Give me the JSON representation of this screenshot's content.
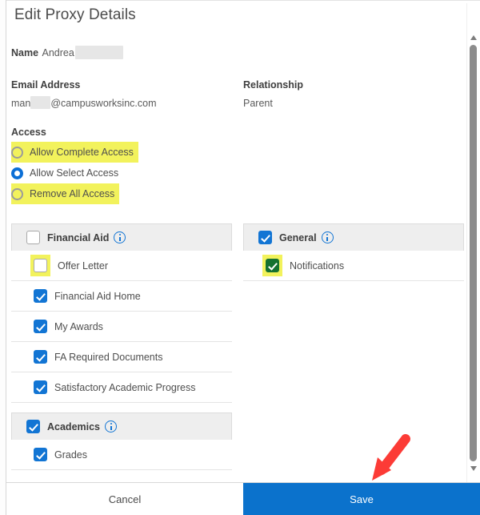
{
  "dialog": {
    "title": "Edit Proxy Details"
  },
  "info": {
    "name_label": "Name",
    "name_value": "Andrea",
    "email_label": "Email Address",
    "email_prefix": "man",
    "email_suffix": "@campusworksinc.com",
    "relationship_label": "Relationship",
    "relationship_value": "Parent"
  },
  "access": {
    "label": "Access",
    "options": [
      {
        "label": "Allow Complete Access",
        "selected": false,
        "highlighted": true
      },
      {
        "label": "Allow Select Access",
        "selected": true,
        "highlighted": false
      },
      {
        "label": "Remove All Access",
        "selected": false,
        "highlighted": true
      }
    ]
  },
  "permissions": {
    "left_column": [
      {
        "group": "Financial Aid",
        "checked": false,
        "has_info_icon": true,
        "items": [
          {
            "label": "Offer Letter",
            "checked": false,
            "highlighted": true,
            "color": "white"
          },
          {
            "label": "Financial Aid Home",
            "checked": true,
            "highlighted": false,
            "color": "blue"
          },
          {
            "label": "My Awards",
            "checked": true,
            "highlighted": false,
            "color": "blue"
          },
          {
            "label": "FA Required Documents",
            "checked": true,
            "highlighted": false,
            "color": "blue"
          },
          {
            "label": "Satisfactory Academic Progress",
            "checked": true,
            "highlighted": false,
            "color": "blue"
          }
        ]
      },
      {
        "group": "Academics",
        "checked": true,
        "has_info_icon": true,
        "items": [
          {
            "label": "Grades",
            "checked": true,
            "highlighted": false,
            "color": "blue"
          }
        ]
      }
    ],
    "right_column": [
      {
        "group": "General",
        "checked": true,
        "has_info_icon": true,
        "items": [
          {
            "label": "Notifications",
            "checked": true,
            "highlighted": true,
            "color": "green"
          }
        ]
      }
    ]
  },
  "footer": {
    "cancel_label": "Cancel",
    "save_label": "Save"
  },
  "annotation": {
    "arrow_color": "#fc3b36",
    "points_to": "save-button"
  },
  "colors": {
    "accent_blue": "#1275d4",
    "save_button_blue": "#0b72cc",
    "highlight_yellow": "#f2f25c",
    "green_check": "#15712f",
    "group_header_gray": "#eeeeee"
  },
  "scrollbar": {
    "orientation": "vertical",
    "position": "near-top"
  }
}
